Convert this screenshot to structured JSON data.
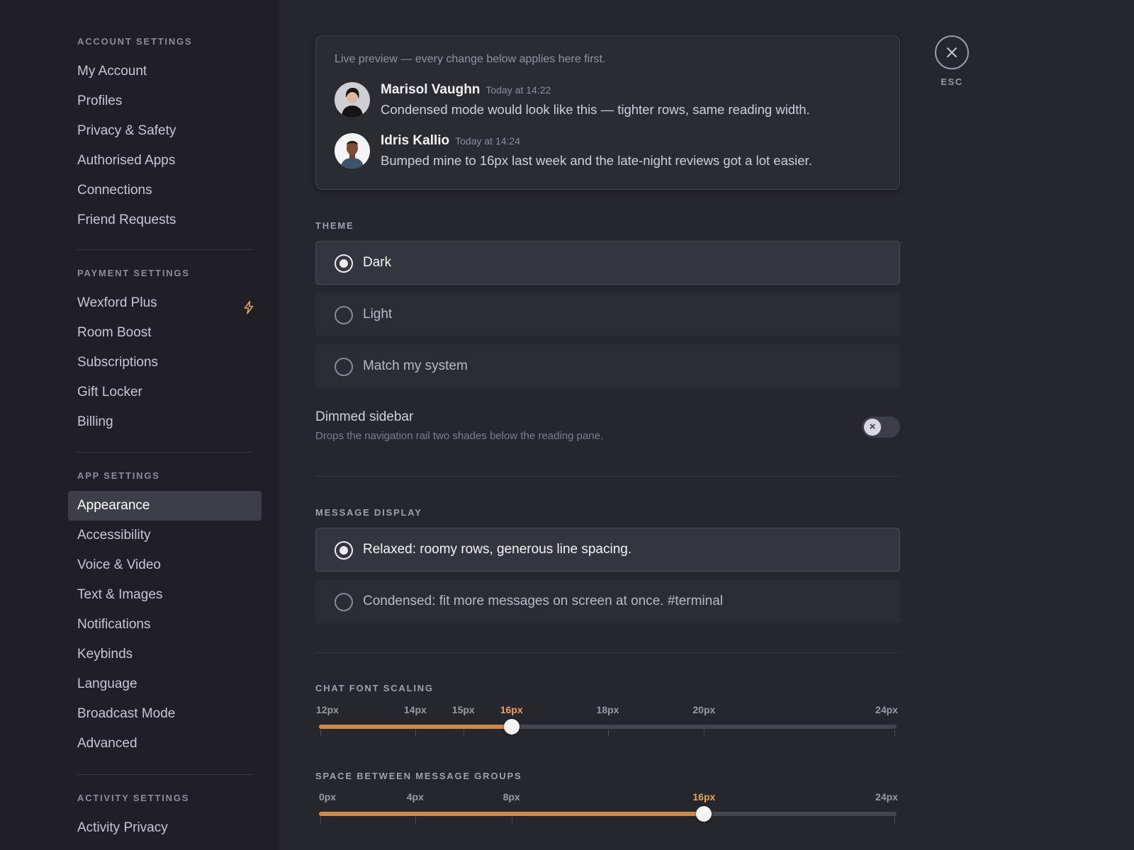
{
  "sidebar": {
    "groups": [
      {
        "header": "ACCOUNT SETTINGS",
        "items": [
          "My Account",
          "Profiles",
          "Privacy & Safety",
          "Authorised Apps",
          "Connections",
          "Friend Requests"
        ]
      },
      {
        "header": "PAYMENT SETTINGS",
        "items": [
          "Wexford Plus",
          "Room Boost",
          "Subscriptions",
          "Gift Locker",
          "Billing"
        ]
      },
      {
        "header": "APP SETTINGS",
        "items": [
          "Appearance",
          "Accessibility",
          "Voice & Video",
          "Text & Images",
          "Notifications",
          "Keybinds",
          "Language",
          "Broadcast Mode",
          "Advanced"
        ]
      },
      {
        "header": "ACTIVITY SETTINGS",
        "items": [
          "Activity Privacy"
        ]
      }
    ],
    "active_item": "Appearance",
    "plus_icon": "bolt-icon",
    "plus_icon_color": "#e8a35c"
  },
  "preview": {
    "hint": "Live preview — every change below applies here first.",
    "messages": [
      {
        "author": "Marisol Vaughn",
        "time": "Today at 14:22",
        "text": "Condensed mode would look like this — tighter rows, same reading width."
      },
      {
        "author": "Idris Kallio",
        "time": "Today at 14:24",
        "text": "Bumped mine to 16px last week and the late-night reviews got a lot easier."
      }
    ]
  },
  "theme": {
    "label": "THEME",
    "options": [
      "Dark",
      "Light",
      "Match my system"
    ],
    "selected": "Dark"
  },
  "dimmed_sidebar": {
    "title": "Dimmed sidebar",
    "description": "Drops the navigation rail two shades below the reading pane.",
    "enabled": false,
    "knob_glyph": "×"
  },
  "message_display": {
    "label": "MESSAGE DISPLAY",
    "options": [
      "Relaxed: roomy rows, generous line spacing.",
      "Condensed: fit more messages on screen at once. #terminal"
    ],
    "selected": "Relaxed: roomy rows, generous line spacing."
  },
  "font_scaling": {
    "label": "CHAT FONT SCALING",
    "ticks": [
      "12px",
      "14px",
      "15px",
      "16px",
      "18px",
      "20px",
      "24px"
    ],
    "tick_values": [
      12,
      14,
      15,
      16,
      18,
      20,
      24
    ],
    "min": 12,
    "max": 24,
    "value": 16,
    "value_label": "16px"
  },
  "group_spacing": {
    "label": "SPACE BETWEEN MESSAGE GROUPS",
    "ticks": [
      "0px",
      "4px",
      "8px",
      "16px",
      "24px"
    ],
    "tick_values": [
      0,
      4,
      8,
      16,
      24
    ],
    "min": 0,
    "max": 24,
    "value": 16,
    "value_label": "16px"
  },
  "close": {
    "label": "ESC",
    "icon": "close-icon"
  },
  "colors": {
    "accent": "#d08a45",
    "accent_text": "#e8a35c"
  }
}
